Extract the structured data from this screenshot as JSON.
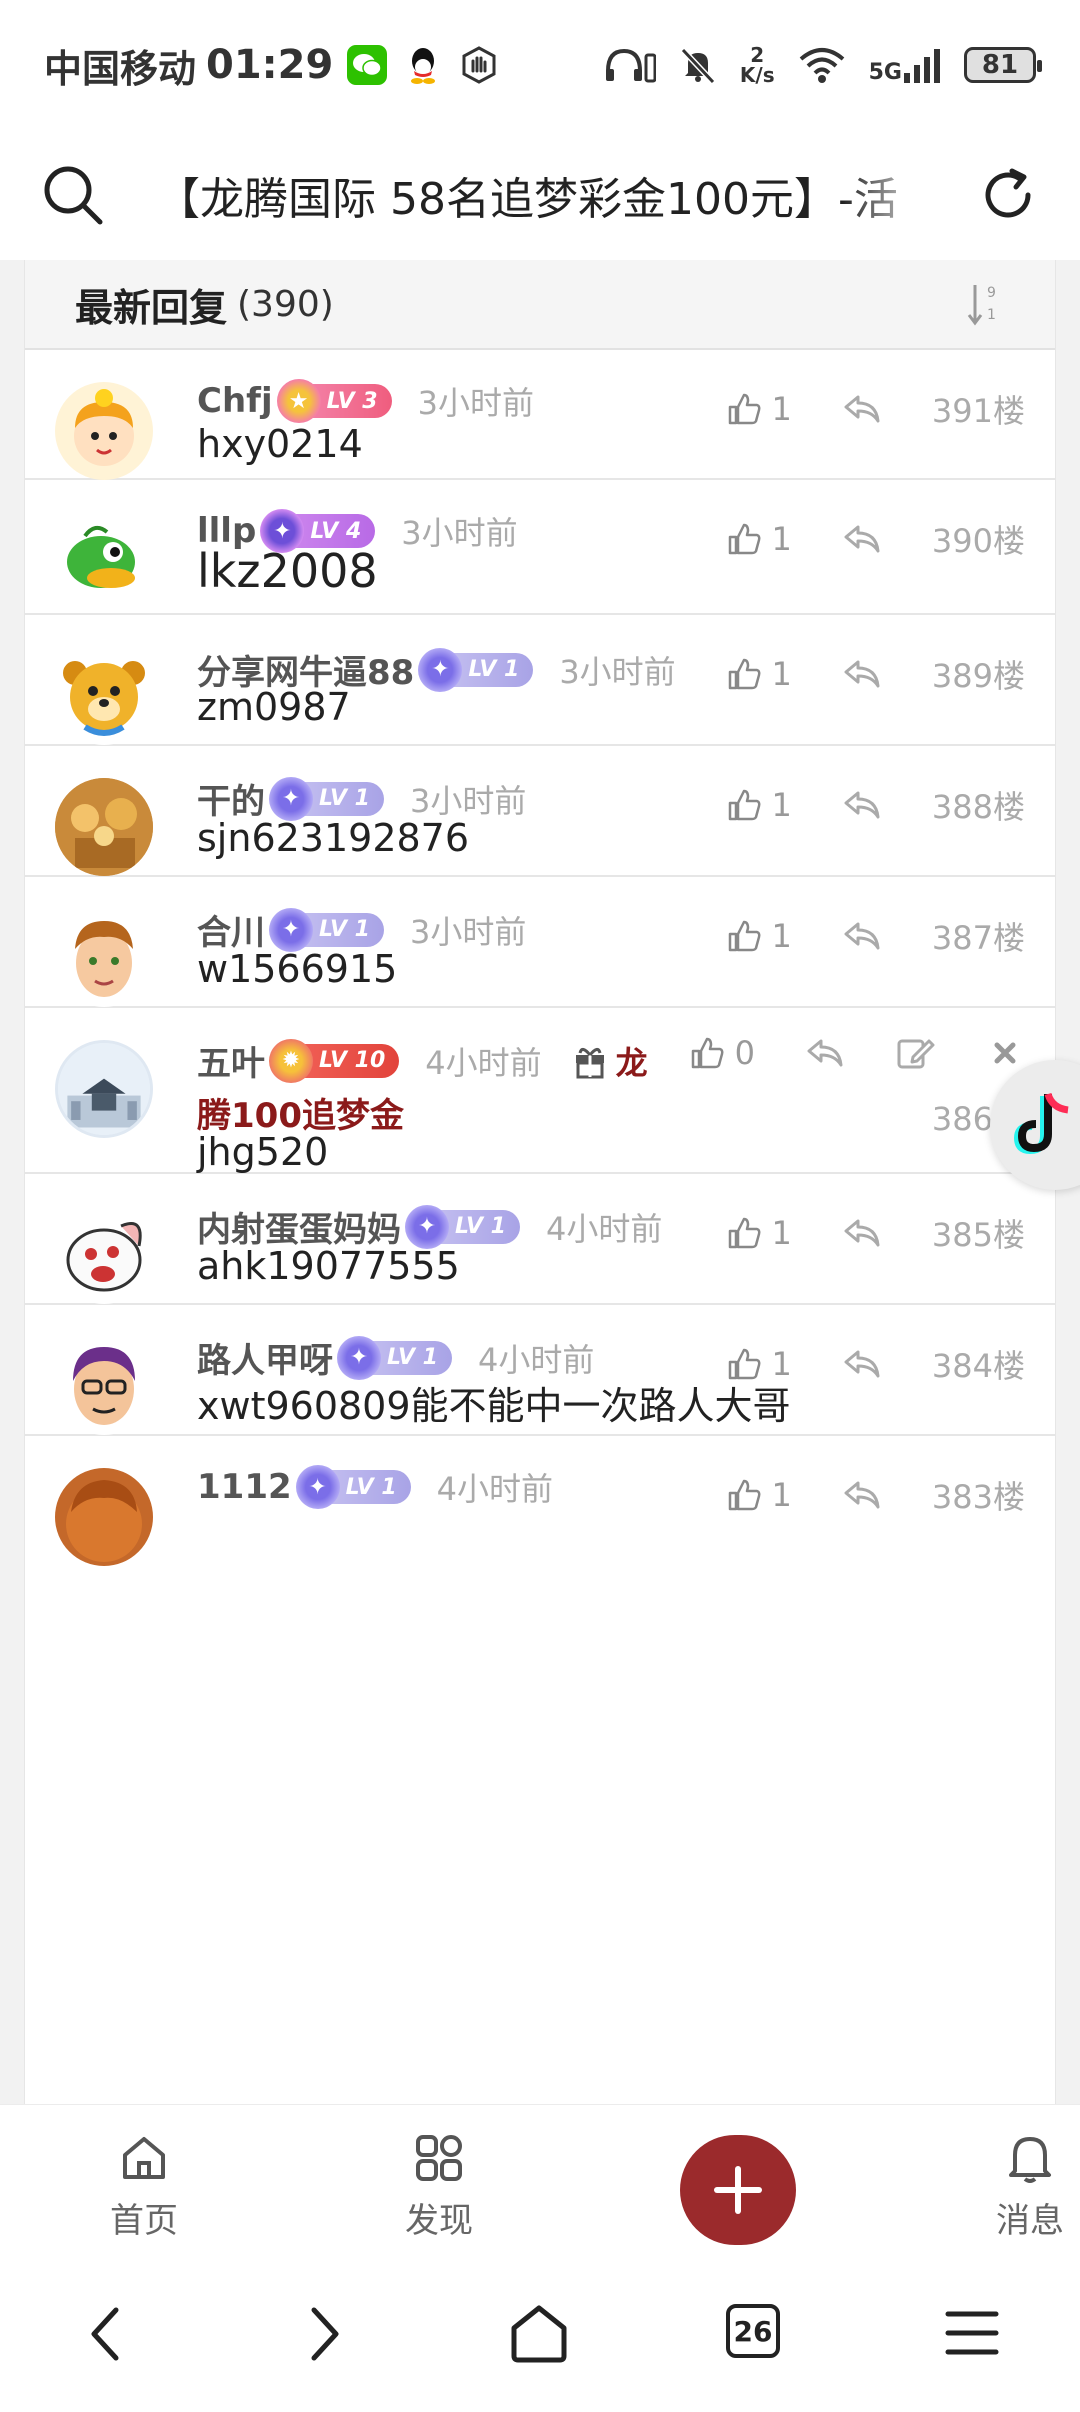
{
  "status_bar": {
    "carrier": "中国移动",
    "time": "01:29",
    "net_speed_value": "2",
    "net_speed_unit": "K/s",
    "signal_label": "5G",
    "battery": "81"
  },
  "title_bar": {
    "title": "【龙腾国际 58名追梦彩金100元】-活"
  },
  "replies_header": {
    "title": "最新回复",
    "count": "(390)"
  },
  "replies": [
    {
      "name": "Chfj",
      "level": "LV 3",
      "time": "3小时前",
      "likes": "1",
      "floor": "391楼",
      "text": "hxy0214"
    },
    {
      "name": "lllp",
      "level": "LV 4",
      "time": "3小时前",
      "likes": "1",
      "floor": "390楼",
      "text": "lkz2008"
    },
    {
      "name": "分享网牛逼88",
      "level": "LV 1",
      "time": "3小时前",
      "likes": "1",
      "floor": "389楼",
      "text": "zm0987"
    },
    {
      "name": "干的",
      "level": "LV 1",
      "time": "3小时前",
      "likes": "1",
      "floor": "388楼",
      "text": "sjn623192876"
    },
    {
      "name": "合川",
      "level": "LV 1",
      "time": "3小时前",
      "likes": "1",
      "floor": "387楼",
      "text": "w1566915"
    },
    {
      "name": "五叶",
      "level": "LV 10",
      "time": "4小时前",
      "likes": "0",
      "floor": "386楼",
      "text": "jhg520",
      "gift_part1": "龙",
      "gift_part2": "腾100追梦金"
    },
    {
      "name": "内射蛋蛋妈妈",
      "level": "LV 1",
      "time": "4小时前",
      "likes": "1",
      "floor": "385楼",
      "text": "ahk19077555"
    },
    {
      "name": "路人甲呀",
      "level": "LV 1",
      "time": "4小时前",
      "likes": "1",
      "floor": "384楼",
      "text": "xwt960809能不能中一次路人大哥"
    },
    {
      "name": "1112",
      "level": "LV 1",
      "time": "4小时前",
      "likes": "1",
      "floor": "383楼",
      "text": ""
    }
  ],
  "bottom_nav": {
    "home": "首页",
    "discover": "发现",
    "messages": "消息"
  },
  "system_nav": {
    "tabs_count": "26"
  },
  "colors": {
    "accent": "#9b2a2c",
    "gift_text": "#8b1a1a",
    "muted": "#aaaaaa"
  }
}
